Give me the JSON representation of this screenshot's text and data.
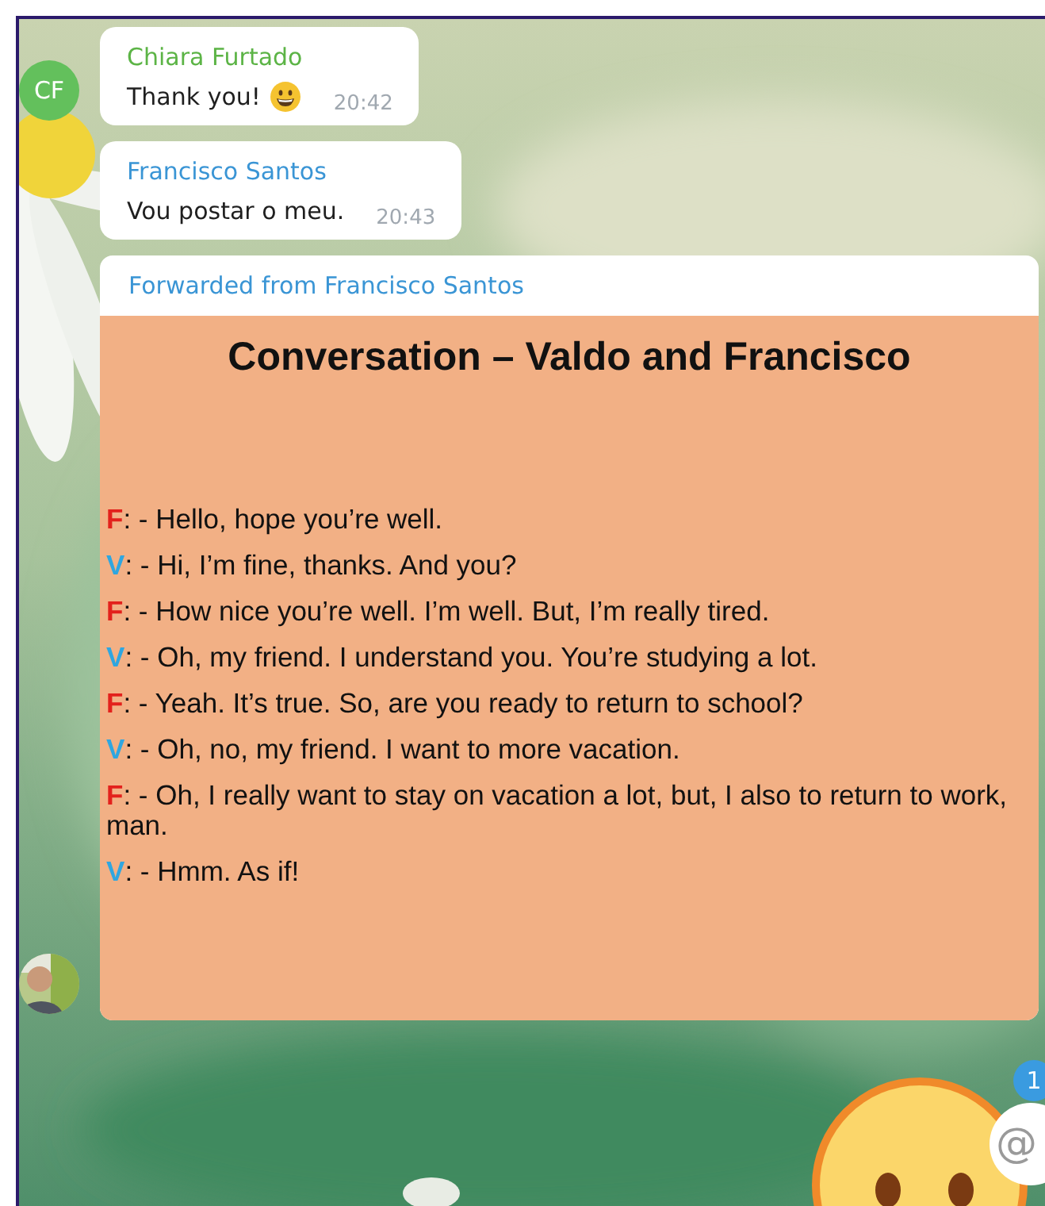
{
  "messages": [
    {
      "kind": "text",
      "sender": "Chiara Furtado",
      "color": "#5cb446",
      "text": "Thank you!",
      "emoji": true,
      "time": "20:42",
      "avatar": {
        "kind": "initials",
        "initials": "CF",
        "color": "#63c05c"
      }
    },
    {
      "kind": "text",
      "sender": "Francisco Santos",
      "color": "#3a95d5",
      "text": "Vou postar o meu.",
      "emoji": false,
      "time": "20:43"
    },
    {
      "kind": "forward",
      "forwarded_from": "Forwarded from Francisco Santos",
      "document": {
        "title": "Conversation – Valdo and Francisco",
        "lines": [
          {
            "speaker": "F",
            "color": "#e3211c",
            "text": ": - Hello, hope you’re well."
          },
          {
            "speaker": "V",
            "color": "#2fa6e0",
            "text": ": - Hi, I’m fine, thanks. And you?"
          },
          {
            "speaker": "F",
            "color": "#e3211c",
            "text": ": - How nice you’re well. I’m well. But, I’m really tired."
          },
          {
            "speaker": "V",
            "color": "#2fa6e0",
            "text": ": - Oh, my friend. I understand you. You’re studying a lot."
          },
          {
            "speaker": "F",
            "color": "#e3211c",
            "text": ": - Yeah. It’s true. So, are you ready to return to school?"
          },
          {
            "speaker": "V",
            "color": "#2fa6e0",
            "text": ": - Oh, no, my friend. I want to more vacation."
          },
          {
            "speaker": "F",
            "color": "#e3211c",
            "text": ": - Oh, I really want to stay on vacation a lot, but, I also to return to work, man."
          },
          {
            "speaker": "V",
            "color": "#2fa6e0",
            "text": ": - Hmm. As if!"
          }
        ]
      }
    }
  ],
  "mention": {
    "badge": "1",
    "button": "@"
  }
}
